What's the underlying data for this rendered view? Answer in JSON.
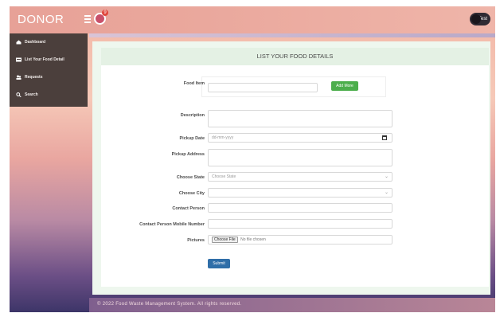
{
  "header": {
    "brand": "DONOR",
    "notification_count": "9",
    "user_name": "Test"
  },
  "sidebar": {
    "items": [
      {
        "label": "Dashboard",
        "icon": "dashboard-icon"
      },
      {
        "label": "List Your Food Detail",
        "icon": "list-icon"
      },
      {
        "label": "Requests",
        "icon": "requests-icon"
      },
      {
        "label": "Search",
        "icon": "search-icon"
      }
    ]
  },
  "form": {
    "title": "LIST YOUR FOOD DETAILS",
    "food_item_label": "Food Item",
    "add_more_label": "Add More",
    "description_label": "Description",
    "pickup_date_label": "Pickup Date",
    "pickup_date_placeholder": "dd-mm-yyyy",
    "pickup_address_label": "Pickup Address",
    "state_label": "Choose State",
    "state_selected": "Choose State",
    "city_label": "Choose City",
    "city_selected": "",
    "contact_person_label": "Contact Person",
    "contact_mobile_label": "Contact Person Mobile Number",
    "pictures_label": "Pictures",
    "choose_file_label": "Choose File",
    "no_file_text": "No file chosen",
    "submit_label": "Submit"
  },
  "footer": {
    "text": "© 2022 Food Waste Management System. All rights reserved."
  },
  "colors": {
    "sidebar_bg": "#4b3f3c",
    "add_button": "#4cae4c",
    "submit_button": "#2f6ea8",
    "header_bg": "#e4f1e4"
  }
}
